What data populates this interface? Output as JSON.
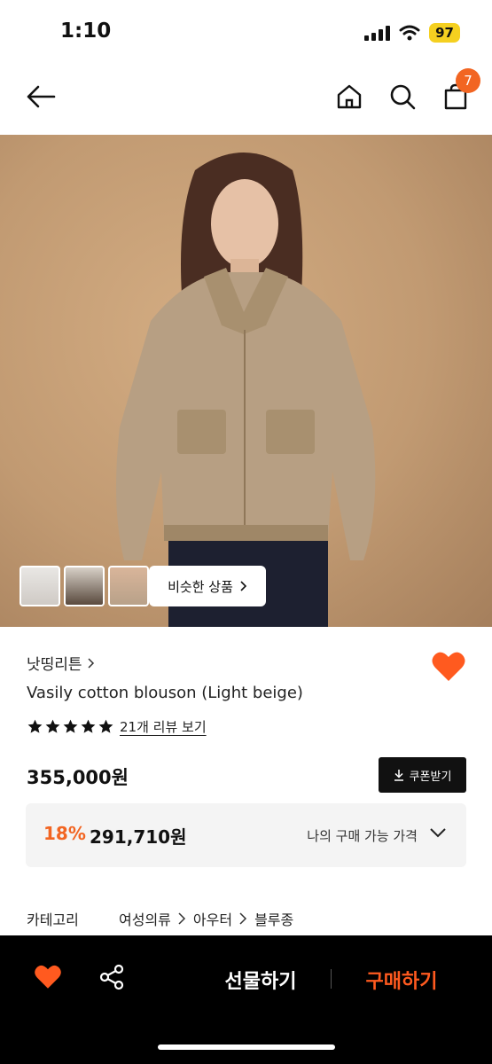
{
  "status": {
    "time": "1:10",
    "battery": "97"
  },
  "header": {
    "cart_count": "7"
  },
  "gallery": {
    "similar_label": "비슷한 상품"
  },
  "product": {
    "brand": "낫띵리튼",
    "name": "Vasily cotton blouson (Light beige)",
    "rating_stars": 5,
    "review_link": "21개 리뷰 보기",
    "price": "355,000원",
    "coupon_label": "쿠폰받기",
    "discount_rate": "18%",
    "discount_price": "291,710원",
    "my_price_label": "나의 구매 가능 가격"
  },
  "category": {
    "label": "카테고리",
    "path": [
      "여성의류",
      "아우터",
      "블루종"
    ]
  },
  "bottom_bar": {
    "gift_label": "선물하기",
    "buy_label": "구매하기"
  },
  "colors": {
    "accent": "#f26522",
    "buy": "#ff5a1f",
    "wish": "#ff5a1f",
    "bar": "#000000"
  },
  "icons": [
    "back-arrow-icon",
    "home-icon",
    "search-icon",
    "cart-icon",
    "chevron-right-icon",
    "heart-icon",
    "star-icon",
    "download-icon",
    "chevron-down-icon",
    "share-icon"
  ]
}
